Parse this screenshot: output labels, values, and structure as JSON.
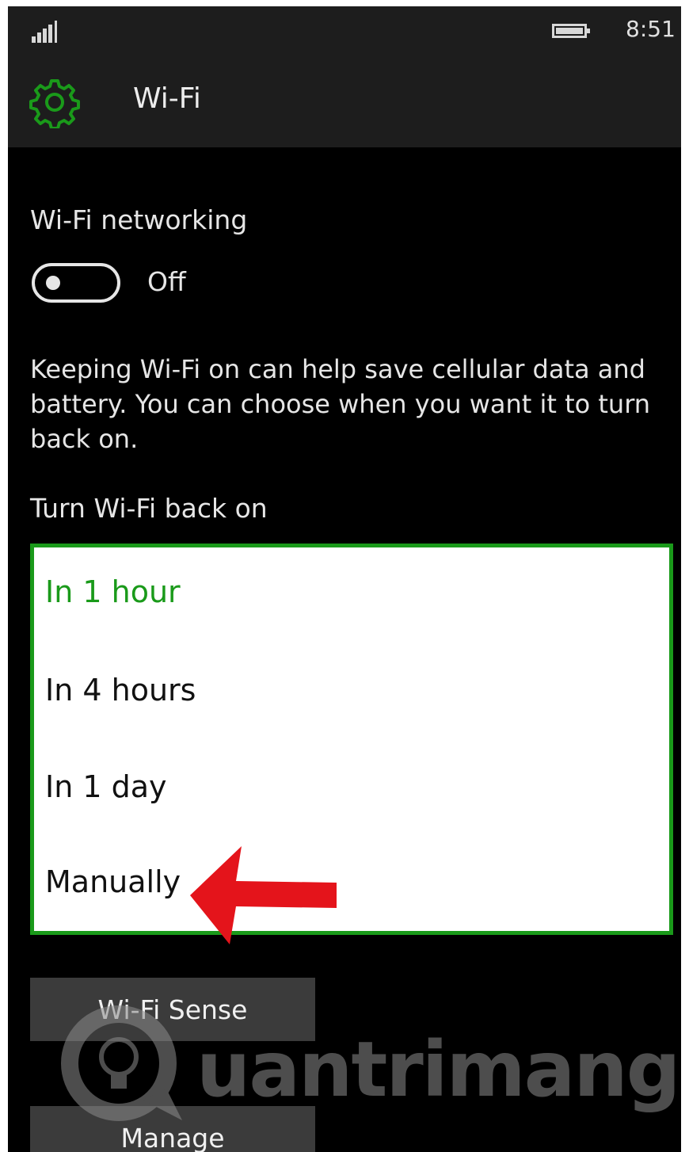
{
  "status_bar": {
    "clock": "8:51",
    "signal_icon": "signal-strength-icon",
    "battery_icon": "battery-icon"
  },
  "header": {
    "icon": "gear-icon",
    "title": "Wi-Fi"
  },
  "wifi_networking": {
    "label": "Wi-Fi networking",
    "toggle_state": "Off"
  },
  "description": "Keeping Wi-Fi on can help save cellular data and battery. You can choose when you want it to turn back on.",
  "turn_back_on": {
    "label": "Turn Wi-Fi back on",
    "options": [
      "In 1 hour",
      "In 4 hours",
      "In 1 day",
      "Manually"
    ],
    "selected": "In 1 hour"
  },
  "buttons": {
    "wifi_sense": "Wi-Fi Sense",
    "manage": "Manage"
  },
  "watermark": {
    "text": "uantrimang"
  },
  "colors": {
    "accent": "#1a9a1a",
    "annotation_arrow": "#e4141b",
    "background": "#000000"
  }
}
